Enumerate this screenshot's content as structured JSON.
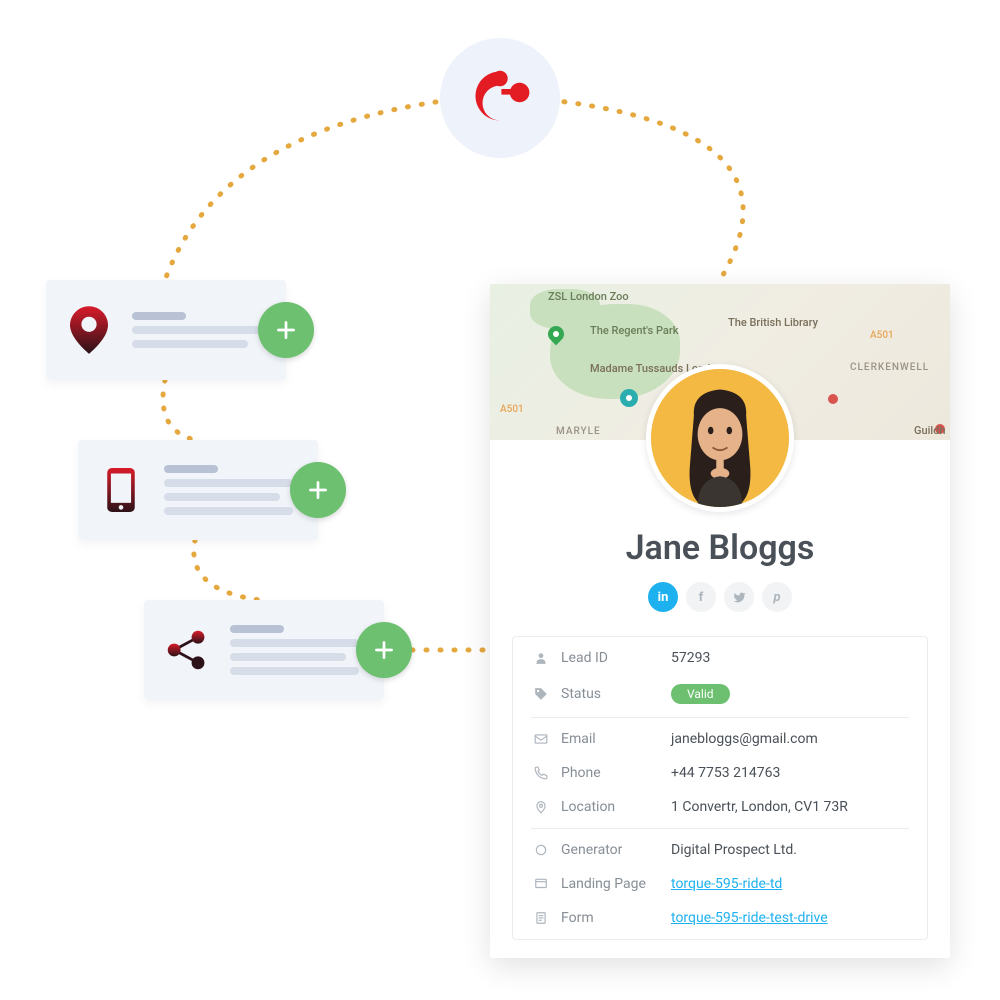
{
  "sources": [
    {
      "icon": "location-pin-icon"
    },
    {
      "icon": "mobile-phone-icon"
    },
    {
      "icon": "share-icon"
    }
  ],
  "map": {
    "labels": [
      "ZSL London Zoo",
      "The Regent's Park",
      "Madame Tussauds London",
      "The British Library",
      "CLERKENWELL",
      "MARYLE",
      "Guildh"
    ],
    "roads": [
      "A501",
      "A501"
    ]
  },
  "profile": {
    "name": "Jane Bloggs",
    "social": [
      "in",
      "f",
      "t",
      "p"
    ],
    "details": {
      "lead_id": {
        "label": "Lead ID",
        "value": "57293"
      },
      "status": {
        "label": "Status",
        "value": "Valid"
      },
      "email": {
        "label": "Email",
        "value": "janebloggs@gmail.com"
      },
      "phone": {
        "label": "Phone",
        "value": "+44 7753 214763"
      },
      "location": {
        "label": "Location",
        "value": "1 Convertr, London, CV1 73R"
      },
      "generator": {
        "label": "Generator",
        "value": "Digital Prospect Ltd."
      },
      "landing_page": {
        "label": "Landing Page",
        "value": "torque-595-ride-td"
      },
      "form": {
        "label": "Form",
        "value": "torque-595-ride-test-drive"
      }
    }
  }
}
